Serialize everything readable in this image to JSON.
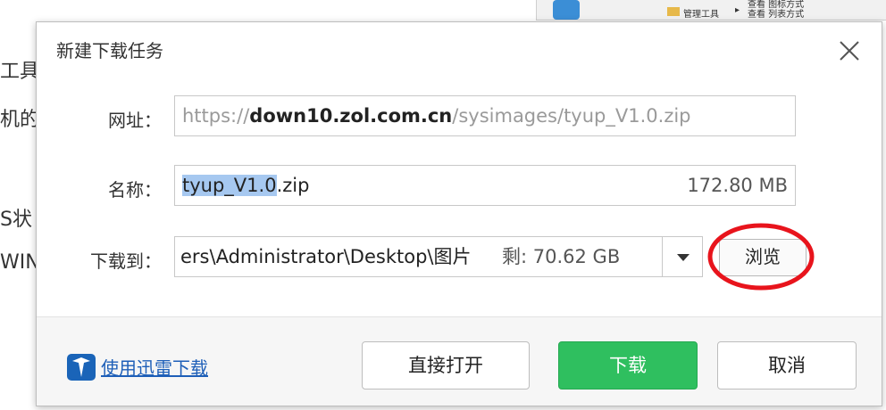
{
  "background": {
    "left_fragments": [
      "工具",
      "机的",
      "S状",
      "WIN"
    ],
    "topright": {
      "menu_item": "管理工具",
      "arrow": "▸",
      "lines": [
        "查看 图标方式",
        "查看 列表方式"
      ]
    }
  },
  "dialog": {
    "title": "新建下载任务",
    "url": {
      "label": "网址：",
      "scheme": "https://",
      "host": "down10.zol.com.cn",
      "path": "/sysimages/tyup_V1.0.zip"
    },
    "name": {
      "label": "名称：",
      "selected": "tyup_V1.0",
      "rest": ".zip",
      "size": "172.80 MB"
    },
    "save_to": {
      "label": "下载到：",
      "path": "ers\\Administrator\\Desktop\\图片",
      "free": "剩: 70.62 GB"
    },
    "browse_label": "浏览",
    "xunlei_link": "使用迅雷下载",
    "buttons": {
      "open": "直接打开",
      "download": "下载",
      "cancel": "取消"
    }
  },
  "colors": {
    "accent_green": "#2fbf5f",
    "link_blue": "#1e5fb8",
    "annotation_red": "#e8141c"
  }
}
